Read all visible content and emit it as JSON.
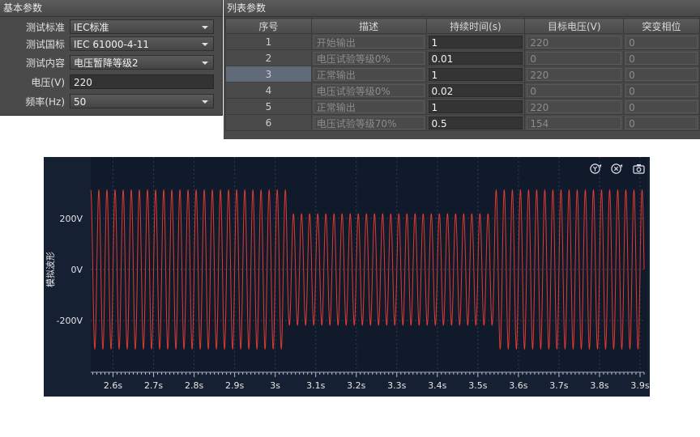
{
  "basic_panel": {
    "title": "基本参数",
    "fields": [
      {
        "label": "测试标准",
        "value": "IEC标准",
        "kind": "select"
      },
      {
        "label": "测试国标",
        "value": "IEC 61000-4-11",
        "kind": "select"
      },
      {
        "label": "测试内容",
        "value": "电压暂降等级2",
        "kind": "select"
      },
      {
        "label": "电压(V)",
        "value": "220",
        "kind": "text"
      },
      {
        "label": "频率(Hz)",
        "value": "50",
        "kind": "select"
      }
    ]
  },
  "list_panel": {
    "title": "列表参数",
    "columns": [
      "序号",
      "描述",
      "持续时间(s)",
      "目标电压(V)",
      "突变相位"
    ],
    "rows": [
      {
        "idx": "1",
        "desc": "开始输出",
        "duration": "1",
        "voltage": "220",
        "phase": "0"
      },
      {
        "idx": "2",
        "desc": "电压试验等级0%",
        "duration": "0.01",
        "voltage": "0",
        "phase": "0"
      },
      {
        "idx": "3",
        "desc": "正常输出",
        "duration": "1",
        "voltage": "220",
        "phase": "0"
      },
      {
        "idx": "4",
        "desc": "电压试验等级0%",
        "duration": "0.02",
        "voltage": "0",
        "phase": "0"
      },
      {
        "idx": "5",
        "desc": "正常输出",
        "duration": "1",
        "voltage": "220",
        "phase": "0"
      },
      {
        "idx": "6",
        "desc": "电压试验等级70%",
        "duration": "0.5",
        "voltage": "154",
        "phase": "0"
      }
    ],
    "selected_row": 2
  },
  "toolbar_icons": [
    "zoom-y-icon",
    "zoom-reset-icon",
    "camera-icon"
  ],
  "chart_data": {
    "type": "line",
    "ylabel": "模拟波形",
    "y_ticks": [
      200,
      0,
      -200
    ],
    "y_tick_labels": [
      "200V",
      "0V",
      "-200V"
    ],
    "ylim": [
      -390,
      390
    ],
    "x_ticks": [
      2.6,
      2.7,
      2.8,
      2.9,
      3.0,
      3.1,
      3.2,
      3.3,
      3.4,
      3.5,
      3.6,
      3.7,
      3.8,
      3.9
    ],
    "x_tick_labels": [
      "2.6s",
      "2.7s",
      "2.8s",
      "2.9s",
      "3s",
      "3.1s",
      "3.2s",
      "3.3s",
      "3.4s",
      "3.5s",
      "3.6s",
      "3.7s",
      "3.8s",
      "3.9s"
    ],
    "xlim": [
      2.545,
      3.91
    ],
    "frequency_hz": 50,
    "segments": [
      {
        "start": 2.545,
        "end": 3.03,
        "amplitude": 311
      },
      {
        "start": 3.03,
        "end": 3.54,
        "amplitude": 218
      },
      {
        "start": 3.54,
        "end": 3.91,
        "amplitude": 311
      }
    ],
    "grid": true,
    "colors": {
      "background": "#162033",
      "line": "#e03a32",
      "grid": "#2e3c55",
      "text": "#e6e6e6"
    }
  }
}
